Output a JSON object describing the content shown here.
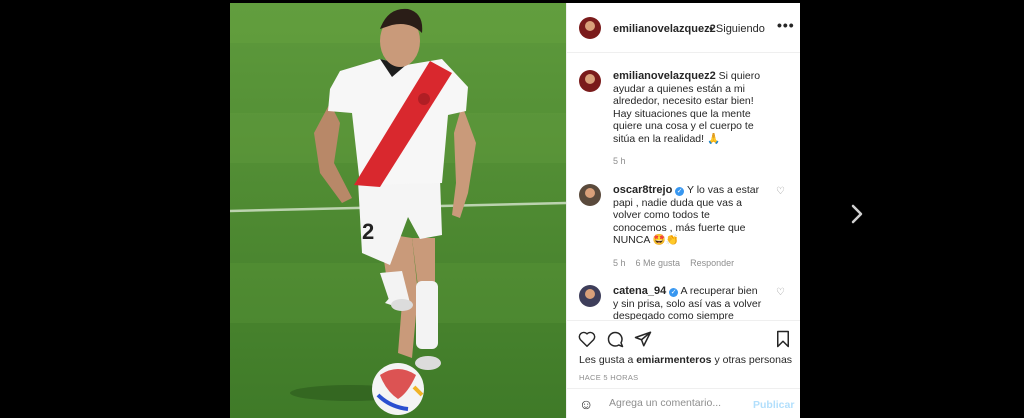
{
  "post": {
    "username": "emilianovelazquez2",
    "follow_status": "• Siguiendo",
    "more_icon": "more-horizontal-icon",
    "caption": "Si quiero ayudar a quienes están a mi alrededor, necesito estar bien! Hay situaciones que la mente quiere una cosa y el cuerpo te sitúa en la realidad! 🙏",
    "caption_time": "5 h"
  },
  "comments": [
    {
      "username": "oscar8trejo",
      "text": "Y lo vas a estar papi , nadie duda que vas a volver como todos te conocemos , más fuerte que NUNCA 🤩👏",
      "time": "5 h",
      "likes": "6 Me gusta",
      "reply": "Responder"
    },
    {
      "username": "catena_94",
      "text": "A recuperar bien y sin prisa, solo así vas a volver despegado como siempre",
      "time": "",
      "likes": "",
      "reply": ""
    }
  ],
  "actions": {
    "likes_prefix": "Les gusta a",
    "likes_user": "emiarmenteros",
    "likes_suffix": "y otras personas",
    "timestamp": "HACE 5 HORAS"
  },
  "composer": {
    "placeholder": "Agrega un comentario...",
    "publish": "Publicar"
  },
  "colors": {
    "verified": "#3897f0",
    "publish_disabled": "#b2dffc",
    "pitch": "#4e8a32"
  }
}
